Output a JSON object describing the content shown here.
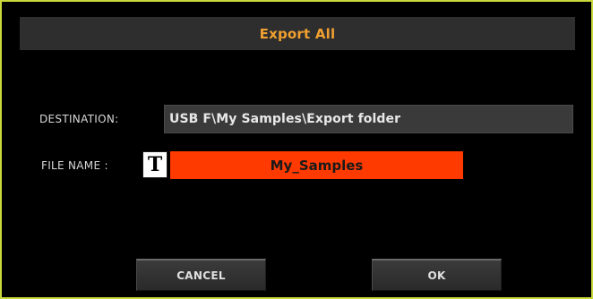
{
  "dialog": {
    "title": "Export All"
  },
  "destination": {
    "label": "DESTINATION:",
    "value": "USB F\\My Samples\\Export folder"
  },
  "file_name": {
    "label": "FILE NAME :",
    "text_button": "T",
    "value": "My_Samples"
  },
  "buttons": {
    "cancel": "CANCEL",
    "ok": "OK"
  },
  "colors": {
    "accent_title": "#f0a030",
    "field_highlight": "#ff3a00",
    "frame_border": "#c8d83a"
  }
}
